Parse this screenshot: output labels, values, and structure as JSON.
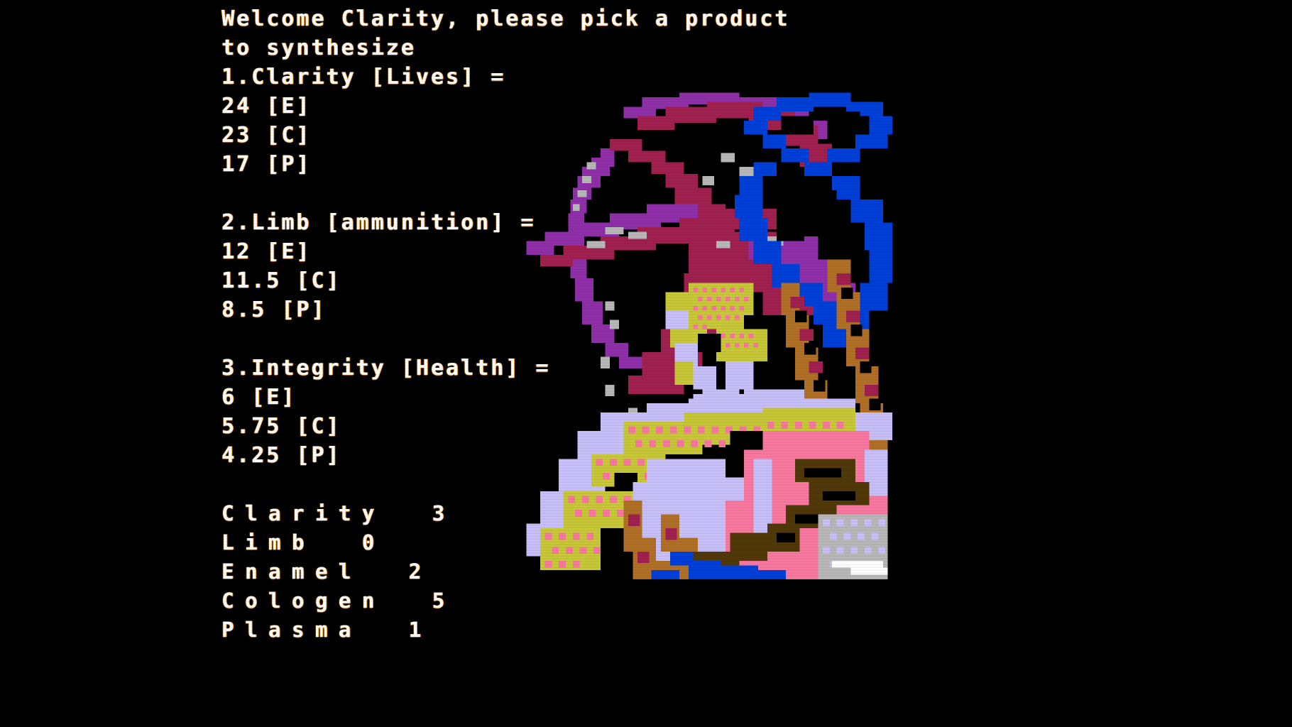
{
  "screen": {
    "background_color": "#000000",
    "text_color": "#ffffff",
    "fringe_color": "#ffa010"
  },
  "console": {
    "header": {
      "line1": "Welcome Clarity, please pick a product",
      "line2": "to synthesize"
    },
    "products": [
      {
        "index": "1",
        "title": "1.Clarity [Lives] =",
        "costs": [
          "24 [E]",
          "23 [C]",
          "17 [P]"
        ]
      },
      {
        "index": "2",
        "title": "2.Limb [ammunition] =",
        "costs": [
          "12 [E]",
          "11.5 [C]",
          "8.5 [P]"
        ]
      },
      {
        "index": "3",
        "title": "3.Integrity [Health] =",
        "costs": [
          "6 [E]",
          "5.75 [C]",
          "4.25 [P]"
        ]
      }
    ],
    "inventory": [
      {
        "name": "Clarity",
        "amount": "3",
        "line": "Clarity  3"
      },
      {
        "name": "Limb",
        "amount": "0",
        "line": "Limb  0"
      },
      {
        "name": "Enamel",
        "amount": "2",
        "line": "Enamel  2"
      },
      {
        "name": "Cologen",
        "amount": "5",
        "line": "Cologen  5"
      },
      {
        "name": "Plasma",
        "amount": "1",
        "line": "Plasma  1"
      }
    ]
  },
  "artwork": {
    "title": "pixel-portrait",
    "palette": {
      "black": "#000000",
      "white": "#ffffff",
      "gray": "#b8b8b8",
      "lavender": "#c8c0f8",
      "blue": "#0040d8",
      "purple": "#9030a8",
      "crimson": "#a02050",
      "pink": "#f878a0",
      "brown": "#b07028",
      "darkbrown": "#503808",
      "yellow": "#c8c838",
      "lightred": "#d04070"
    }
  }
}
